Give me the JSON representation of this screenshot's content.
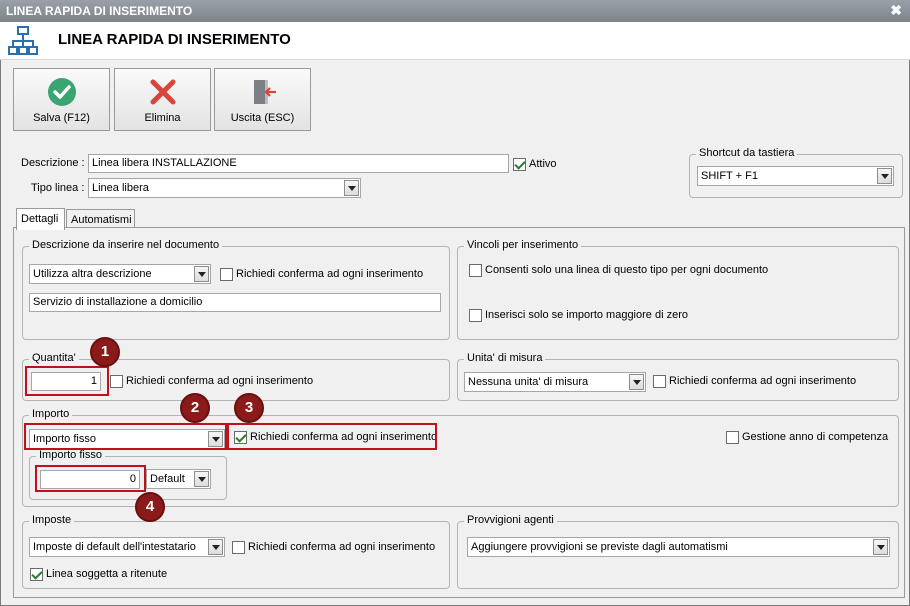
{
  "window": {
    "titlebar_title": "LINEA RAPIDA DI INSERIMENTO",
    "header_title": "LINEA RAPIDA DI INSERIMENTO",
    "close_glyph": "✖"
  },
  "toolbar": {
    "save_label": "Salva (F12)",
    "delete_label": "Elimina",
    "exit_label": "Uscita (ESC)"
  },
  "form": {
    "descrizione_label": "Descrizione :",
    "descrizione_value": "Linea libera INSTALLAZIONE",
    "attivo_label": "Attivo",
    "attivo_checked": true,
    "tipo_linea_label": "Tipo linea :",
    "tipo_linea_value": "Linea libera"
  },
  "shortcut": {
    "group_label": "Shortcut da tastiera",
    "value": "SHIFT + F1"
  },
  "tabs": [
    {
      "label": "Dettagli",
      "active": true
    },
    {
      "label": "Automatismi",
      "active": false
    }
  ],
  "descrizione_doc": {
    "group_label": "Descrizione da inserire nel documento",
    "select_value": "Utilizza altra descrizione",
    "confirm_label": "Richiedi conferma ad ogni inserimento",
    "text_value": "Servizio di installazione a domicilio"
  },
  "vincoli": {
    "group_label": "Vincoli per inserimento",
    "option1": "Consenti solo una linea di questo tipo per ogni documento",
    "option2": "Inserisci solo se importo maggiore di zero"
  },
  "quantita": {
    "group_label": "Quantita'",
    "value": "1",
    "confirm_label": "Richiedi conferma ad ogni inserimento"
  },
  "unita": {
    "group_label": "Unita' di misura",
    "select_value": "Nessuna unita' di misura",
    "confirm_label": "Richiedi conferma ad ogni inserimento"
  },
  "importo": {
    "group_label": "Importo",
    "select_value": "Importo fisso",
    "confirm_label": "Richiedi conferma ad ogni inserimento",
    "confirm_checked": true,
    "competenza_label": "Gestione anno di competenza",
    "fisso_group_label": "Importo fisso",
    "fisso_value": "0",
    "fisso_mode": "Default"
  },
  "imposte": {
    "group_label": "Imposte",
    "select_value": "Imposte di default dell'intestatario",
    "confirm_label": "Richiedi conferma ad ogni inserimento",
    "ritenute_label": "Linea soggetta a ritenute",
    "ritenute_checked": true
  },
  "provvigioni": {
    "group_label": "Provvigioni agenti",
    "select_value": "Aggiungere provvigioni se previste dagli automatismi"
  },
  "callouts": [
    "1",
    "2",
    "3",
    "4"
  ],
  "colors": {
    "callout_fill": "#8b1b1b",
    "highlight_border": "#c0101e",
    "save_icon": "#3aa572",
    "delete_icon": "#d9453a",
    "app_icon": "#2a6fb0"
  }
}
